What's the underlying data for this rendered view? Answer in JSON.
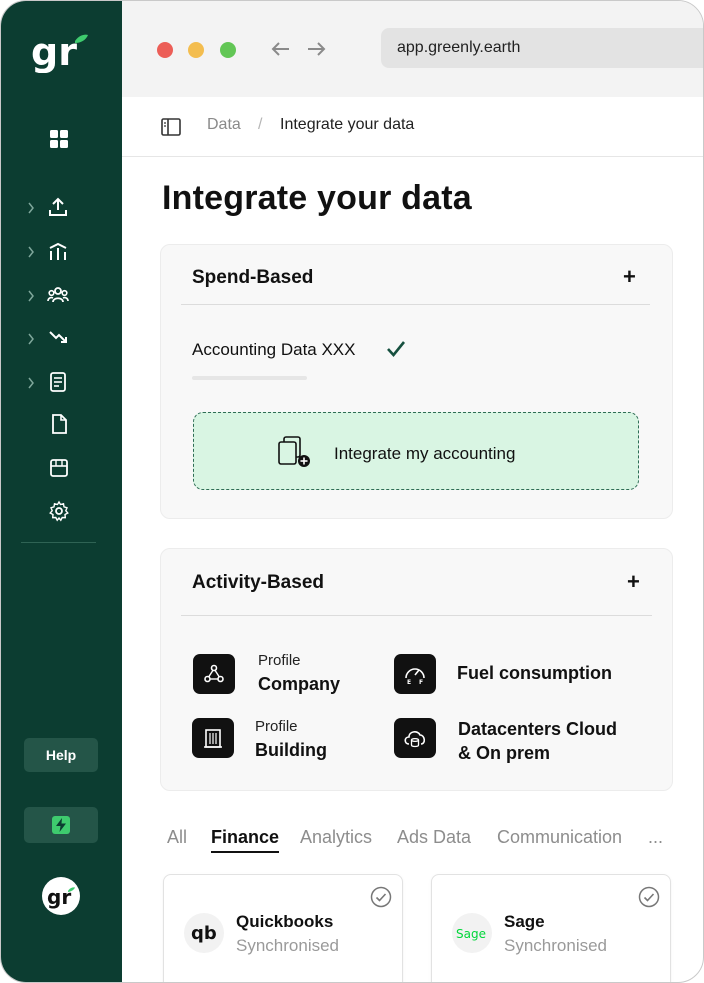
{
  "app": {
    "logo_text": "gr",
    "brand_color": "#0c3d31",
    "accent_color": "#3ecb6e"
  },
  "sidebar": {
    "items": [
      {
        "icon": "dashboard-grid-icon",
        "expandable": false
      },
      {
        "icon": "upload-icon",
        "expandable": true
      },
      {
        "icon": "chart-bars-icon",
        "expandable": true
      },
      {
        "icon": "team-icon",
        "expandable": true
      },
      {
        "icon": "trend-down-icon",
        "expandable": true
      },
      {
        "icon": "report-icon",
        "expandable": true
      },
      {
        "icon": "document-icon",
        "expandable": false
      },
      {
        "icon": "store-icon",
        "expandable": false
      },
      {
        "icon": "gear-icon",
        "expandable": false
      }
    ],
    "help_label": "Help",
    "avatar_text": "gr"
  },
  "browser": {
    "url": "app.greenly.earth"
  },
  "breadcrumb": {
    "parent": "Data",
    "separator": "/",
    "current": "Integrate your data"
  },
  "page": {
    "title": "Integrate your data"
  },
  "spend_based": {
    "title": "Spend-Based",
    "add": "+",
    "account_label": "Accounting Data XXX",
    "integrate_label": "Integrate my accounting"
  },
  "activity_based": {
    "title": "Activity-Based",
    "add": "+",
    "items": [
      {
        "small": "Profile",
        "big": "Company",
        "icon": "network-icon"
      },
      {
        "small": "",
        "big": "Fuel consumption",
        "icon": "fuel-gauge-icon"
      },
      {
        "small": "Profile",
        "big": "Building",
        "icon": "building-icon"
      },
      {
        "small": "",
        "big": "Datacenters Cloud",
        "big2": "& On prem",
        "icon": "cloud-database-icon"
      }
    ]
  },
  "tabs": {
    "items": [
      "All",
      "Finance",
      "Analytics",
      "Ads Data",
      "Communication",
      "..."
    ],
    "active": "Finance"
  },
  "integrations": [
    {
      "name": "Quickbooks",
      "status": "Synchronised",
      "logo": "qb"
    },
    {
      "name": "Sage",
      "status": "Synchronised",
      "logo": "Sage"
    }
  ]
}
